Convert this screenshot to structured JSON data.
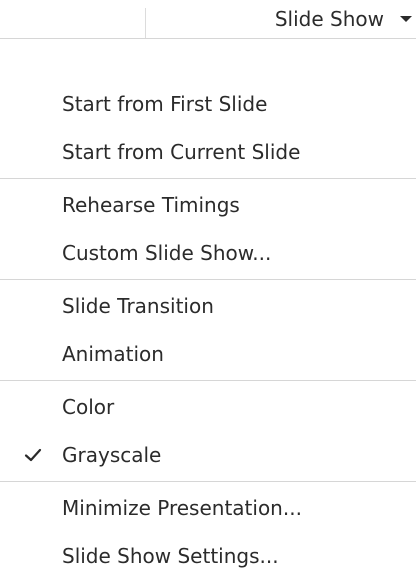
{
  "toolbar": {
    "button_label": "Slide Show",
    "arrow_icon": "chevron-down-icon"
  },
  "menu": {
    "groups": [
      {
        "items": [
          {
            "label": "Start from First Slide"
          },
          {
            "label": "Start from Current Slide"
          }
        ]
      },
      {
        "items": [
          {
            "label": "Rehearse Timings"
          },
          {
            "label": "Custom Slide Show..."
          }
        ]
      },
      {
        "items": [
          {
            "label": "Slide Transition"
          },
          {
            "label": "Animation"
          }
        ]
      },
      {
        "items": [
          {
            "label": "Color"
          },
          {
            "label": "Grayscale",
            "checked": true
          }
        ]
      },
      {
        "items": [
          {
            "label": "Minimize Presentation..."
          },
          {
            "label": "Slide Show Settings..."
          }
        ]
      }
    ]
  },
  "colors": {
    "text": "#2b2b2b",
    "separator": "#d6d6d6"
  }
}
